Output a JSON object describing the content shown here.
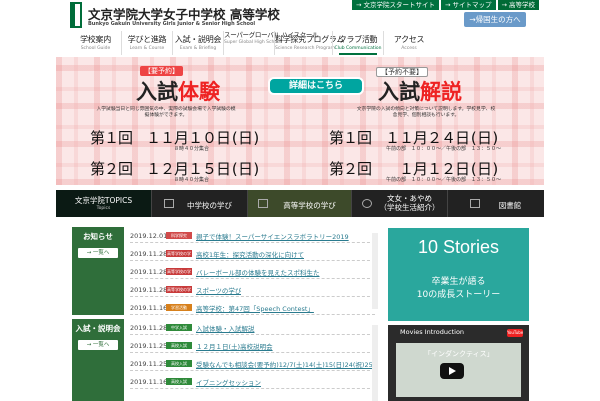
{
  "header": {
    "title": "文京学院大学女子中学校 高等学校",
    "subtitle": "Bunkyo Gakuin University Girls Junior & Senior High School",
    "top_links": [
      "→ 文京学院スタートサイト",
      "→ サイトマップ",
      "→ 高等学校"
    ],
    "kikoku_label": "→帰国生の方へ"
  },
  "nav": [
    {
      "ja": "学校案内",
      "en": "School Guide"
    },
    {
      "ja": "学びと進路",
      "en": "Learn & Course"
    },
    {
      "ja": "入試・説明会",
      "en": "Exam & Briefing"
    },
    {
      "ja": "スーパーグローバル ハイスクール",
      "en": "Super Global High School"
    },
    {
      "ja": "科学探究プログラム",
      "en": "Science Research Program"
    },
    {
      "ja": "クラブ活動",
      "en": "Club Communication"
    },
    {
      "ja": "アクセス",
      "en": "Access"
    }
  ],
  "hero": {
    "left_badge": "【要予約】",
    "left_big_a": "入試",
    "left_big_b": "体験",
    "left_desc": "入学試験当日と同じ雰囲気の中、実際の試験会場で入学試験の模擬体験ができます。",
    "details_button": "詳細はこちら",
    "right_badge": "【予約不要】",
    "right_big_a": "入試",
    "right_big_b": "解説",
    "right_desc": "文京学院の入試の傾向と対策について説明します。学校見学、校舎見学、個別相談も行います。",
    "dates": [
      {
        "label": "第１回　１１月１０日(日)",
        "note": "８時４０分集合"
      },
      {
        "label": "第２回　１２月１５日(日)",
        "note": "８時４０分集合"
      },
      {
        "label": "第１回　１１月２４日(日)",
        "note": "午前の部　１０：００〜／午後の部　１３：５０〜"
      },
      {
        "label": "第２回　　１月１２日(日)",
        "note": "午前の部　１０：００〜／午後の部　１３：５０〜"
      }
    ]
  },
  "strip": [
    {
      "title": "文京学院TOPICS",
      "sub": "Topics"
    },
    {
      "title": "中学校の学び",
      "sub": ""
    },
    {
      "title": "高等学校の学び",
      "sub": ""
    },
    {
      "title": "文女・あやめ\n（学校生活紹介）",
      "sub": ""
    },
    {
      "title": "図書館",
      "sub": ""
    }
  ],
  "news": {
    "section_title": "お知らせ",
    "more": "→ 一覧へ",
    "items": [
      {
        "date": "2019.12.01",
        "tag": "科学探究",
        "tag_color": "#d14a4a",
        "text": "親子で体験！スーパーサイエンスラボラトリー2019"
      },
      {
        "date": "2019.11.28",
        "tag": "高等学校の学び",
        "tag_color": "#c83b3b",
        "text": "高校1年生：探究活動の深化に向けて"
      },
      {
        "date": "2019.11.28",
        "tag": "高等学校の学び",
        "tag_color": "#c83b3b",
        "text": "バレーボール部の体験を見えたスポ科生た"
      },
      {
        "date": "2019.11.28",
        "tag": "高等学校の学び",
        "tag_color": "#c83b3b",
        "text": "スポーツの学び"
      },
      {
        "date": "2019.11.16",
        "tag": "学習活動",
        "tag_color": "#d7801c",
        "text": "高等学校：第47回「Speech Contest」"
      }
    ]
  },
  "exam": {
    "section_title": "入試・説明会",
    "more": "→ 一覧へ",
    "items": [
      {
        "date": "2019.11.28",
        "tag": "中学入試",
        "tag_color": "#2f8a3a",
        "text": "入試体験・入試解説"
      },
      {
        "date": "2019.11.25",
        "tag": "高校入試",
        "tag_color": "#2f8a3a",
        "text": "１２月１日(土)高校説明会"
      },
      {
        "date": "2019.11.25",
        "tag": "高校入試",
        "tag_color": "#2f8a3a",
        "text": "受験なんでも相談会(要予約)12/7(土)14(土)15(日)24(祝)25(水)"
      },
      {
        "date": "2019.11.16",
        "tag": "高校入試",
        "tag_color": "#2f8a3a",
        "text": "イブニングセッション"
      }
    ]
  },
  "stories": {
    "title": "10 Stories",
    "line1": "卒業生が語る",
    "line2": "10の成長ストーリー"
  },
  "movies": {
    "title": "Movies Introduction",
    "yt": "YouTube",
    "caption": "「インダンクティス」"
  },
  "colors": {
    "brand_green": "#00713e",
    "teal": "#2aa79d",
    "accent_red": "#e22222"
  }
}
